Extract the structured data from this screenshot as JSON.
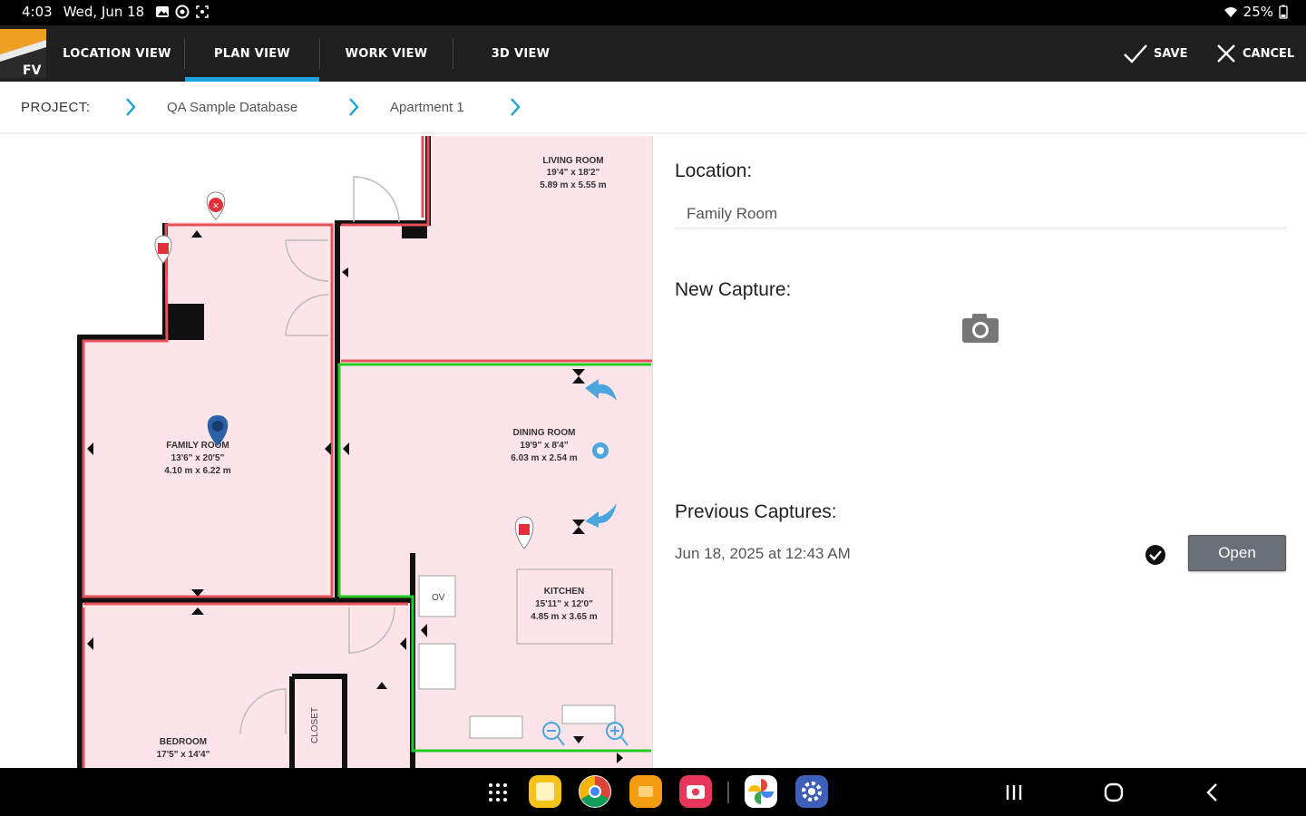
{
  "status_bar": {
    "time": "4:03",
    "date": "Wed, Jun 18",
    "battery": "25%"
  },
  "app_bar": {
    "logo_text": "FV",
    "tabs": [
      {
        "label": "LOCATION VIEW",
        "active": false
      },
      {
        "label": "PLAN VIEW",
        "active": true
      },
      {
        "label": "WORK VIEW",
        "active": false
      },
      {
        "label": "3D VIEW",
        "active": false
      }
    ],
    "save_label": "SAVE",
    "cancel_label": "CANCEL"
  },
  "breadcrumb": {
    "label": "PROJECT:",
    "items": [
      "QA Sample Database",
      "Apartment 1"
    ]
  },
  "plan": {
    "rooms": [
      {
        "name": "LIVING ROOM",
        "dim_imperial": "19'4\" x 18'2\"",
        "dim_metric": "5.89 m x 5.55 m"
      },
      {
        "name": "FAMILY ROOM",
        "dim_imperial": "13'6\" x 20'5\"",
        "dim_metric": "4.10 m x 6.22 m"
      },
      {
        "name": "DINING ROOM",
        "dim_imperial": "19'9\" x 8'4\"",
        "dim_metric": "6.03 m x 2.54 m"
      },
      {
        "name": "KITCHEN",
        "dim_imperial": "15'11\" x 12'0\"",
        "dim_metric": "4.85 m x 3.65 m"
      },
      {
        "name": "BEDROOM",
        "dim_imperial": "17'5\" x 14'4\"",
        "dim_metric": ""
      }
    ],
    "closet_label": "CLOSET",
    "oven_label": "OV",
    "accent_wall": "#e8505b",
    "accent_selected": "#22cc22",
    "room_fill": "#fde4e8"
  },
  "panel": {
    "location_label": "Location:",
    "location_value": "Family Room",
    "new_capture_label": "New Capture:",
    "previous_captures_label": "Previous Captures:",
    "captures": [
      {
        "date": "Jun 18, 2025 at 12:43 AM",
        "open_label": "Open",
        "checked": true
      }
    ]
  },
  "nav_bar": {
    "apps": [
      "apps-grid-icon",
      "notes-app-icon",
      "chrome-app-icon",
      "orange-app-icon",
      "camera-app-icon",
      "photos-app-icon",
      "settings-app-icon"
    ]
  }
}
